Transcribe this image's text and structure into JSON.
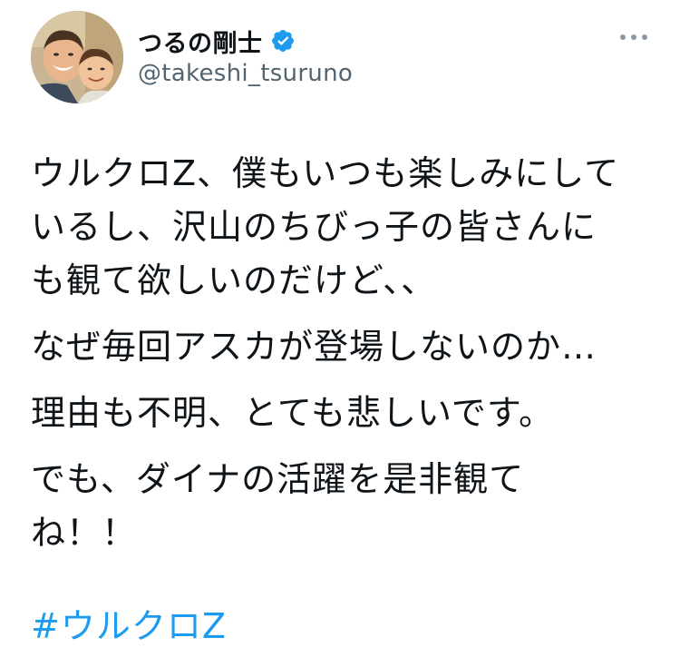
{
  "author": {
    "display_name": "つるの剛士",
    "handle": "@takeshi_tsuruno",
    "verified": true
  },
  "tweet": {
    "paragraphs": [
      "ウルクロZ、僕もいつも楽しみにして\nいるし、沢山のちびっ子の皆さんに\nも観て欲しいのだけど、、",
      "なぜ毎回アスカが登場しないのか…",
      "理由も不明、とても悲しいです。",
      "でも、ダイナの活躍を是非観て\nね！！"
    ],
    "hashtag": "#ウルクロZ"
  },
  "icons": {
    "more": "more-horizontal-icon",
    "verified": "verified-badge-icon"
  },
  "colors": {
    "accent": "#1d9bf0",
    "secondary_text": "#536471",
    "primary_text": "#0f1419"
  }
}
